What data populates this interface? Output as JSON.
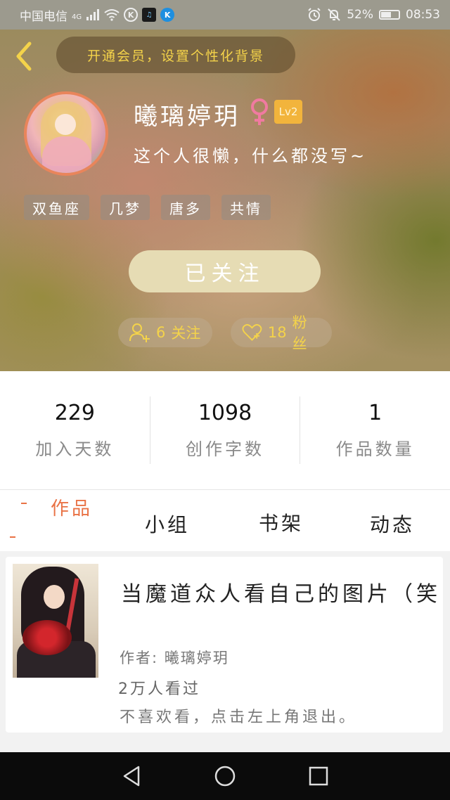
{
  "status_bar": {
    "carrier": "中国电信",
    "network": "4G",
    "battery_percent": "52%",
    "battery_level": 0.52,
    "time": "08:53",
    "icons": [
      "signal-icon",
      "wifi-icon",
      "k-app-icon",
      "music-app-icon",
      "k-blue-app-icon",
      "alarm-icon",
      "mute-icon",
      "battery-icon"
    ]
  },
  "header": {
    "back_icon": "chevron-left-icon",
    "vip_banner": "开通会员，设置个性化背景",
    "username": "曦璃婷玥",
    "gender_icon": "female-icon",
    "level": "Lv2",
    "bio": "这个人很懒，什么都没写~",
    "tags": [
      "双鱼座",
      "几梦",
      "唐多",
      "共情"
    ],
    "follow_button": "已关注",
    "following": {
      "icon": "add-user-icon",
      "count": "6",
      "label": "关注"
    },
    "fans": {
      "icon": "heart-icon",
      "count": "18",
      "label": "粉丝"
    },
    "accent_color": "#f4d34a"
  },
  "stats": [
    {
      "value": "229",
      "label": "加入天数"
    },
    {
      "value": "1098",
      "label": "创作字数"
    },
    {
      "value": "1",
      "label": "作品数量"
    }
  ],
  "tabs": [
    {
      "label": "作品",
      "active": true
    },
    {
      "label": "小组",
      "active": false
    },
    {
      "label": "书架",
      "active": false
    },
    {
      "label": "动态",
      "active": false
    }
  ],
  "works": [
    {
      "title": "当魔道众人看自己的图片（笑",
      "author_label": "作者:",
      "author": "曦璃婷玥",
      "views": "2万人看过",
      "description": "不喜欢看，点击左上角退出。"
    }
  ],
  "nav_bar": {
    "icons": [
      "back-triangle-icon",
      "home-circle-icon",
      "recents-square-icon"
    ]
  },
  "colors": {
    "active_tab": "#e97245",
    "level_badge": "#f2b43c",
    "avatar_border": "#e9855b"
  }
}
